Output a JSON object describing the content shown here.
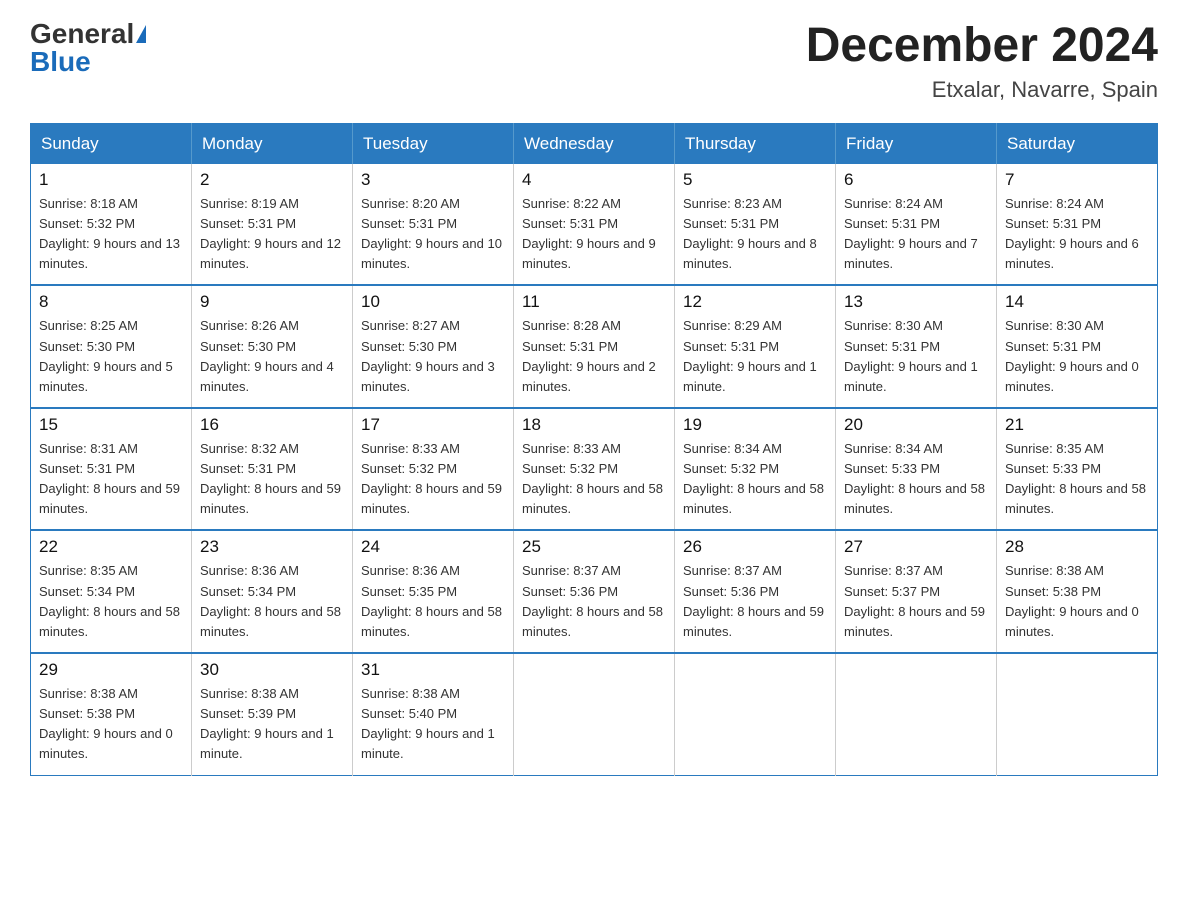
{
  "header": {
    "logo_general": "General",
    "logo_blue": "Blue",
    "month_title": "December 2024",
    "location": "Etxalar, Navarre, Spain"
  },
  "days_of_week": [
    "Sunday",
    "Monday",
    "Tuesday",
    "Wednesday",
    "Thursday",
    "Friday",
    "Saturday"
  ],
  "weeks": [
    [
      {
        "day": "1",
        "sunrise": "8:18 AM",
        "sunset": "5:32 PM",
        "daylight": "9 hours and 13 minutes."
      },
      {
        "day": "2",
        "sunrise": "8:19 AM",
        "sunset": "5:31 PM",
        "daylight": "9 hours and 12 minutes."
      },
      {
        "day": "3",
        "sunrise": "8:20 AM",
        "sunset": "5:31 PM",
        "daylight": "9 hours and 10 minutes."
      },
      {
        "day": "4",
        "sunrise": "8:22 AM",
        "sunset": "5:31 PM",
        "daylight": "9 hours and 9 minutes."
      },
      {
        "day": "5",
        "sunrise": "8:23 AM",
        "sunset": "5:31 PM",
        "daylight": "9 hours and 8 minutes."
      },
      {
        "day": "6",
        "sunrise": "8:24 AM",
        "sunset": "5:31 PM",
        "daylight": "9 hours and 7 minutes."
      },
      {
        "day": "7",
        "sunrise": "8:24 AM",
        "sunset": "5:31 PM",
        "daylight": "9 hours and 6 minutes."
      }
    ],
    [
      {
        "day": "8",
        "sunrise": "8:25 AM",
        "sunset": "5:30 PM",
        "daylight": "9 hours and 5 minutes."
      },
      {
        "day": "9",
        "sunrise": "8:26 AM",
        "sunset": "5:30 PM",
        "daylight": "9 hours and 4 minutes."
      },
      {
        "day": "10",
        "sunrise": "8:27 AM",
        "sunset": "5:30 PM",
        "daylight": "9 hours and 3 minutes."
      },
      {
        "day": "11",
        "sunrise": "8:28 AM",
        "sunset": "5:31 PM",
        "daylight": "9 hours and 2 minutes."
      },
      {
        "day": "12",
        "sunrise": "8:29 AM",
        "sunset": "5:31 PM",
        "daylight": "9 hours and 1 minute."
      },
      {
        "day": "13",
        "sunrise": "8:30 AM",
        "sunset": "5:31 PM",
        "daylight": "9 hours and 1 minute."
      },
      {
        "day": "14",
        "sunrise": "8:30 AM",
        "sunset": "5:31 PM",
        "daylight": "9 hours and 0 minutes."
      }
    ],
    [
      {
        "day": "15",
        "sunrise": "8:31 AM",
        "sunset": "5:31 PM",
        "daylight": "8 hours and 59 minutes."
      },
      {
        "day": "16",
        "sunrise": "8:32 AM",
        "sunset": "5:31 PM",
        "daylight": "8 hours and 59 minutes."
      },
      {
        "day": "17",
        "sunrise": "8:33 AM",
        "sunset": "5:32 PM",
        "daylight": "8 hours and 59 minutes."
      },
      {
        "day": "18",
        "sunrise": "8:33 AM",
        "sunset": "5:32 PM",
        "daylight": "8 hours and 58 minutes."
      },
      {
        "day": "19",
        "sunrise": "8:34 AM",
        "sunset": "5:32 PM",
        "daylight": "8 hours and 58 minutes."
      },
      {
        "day": "20",
        "sunrise": "8:34 AM",
        "sunset": "5:33 PM",
        "daylight": "8 hours and 58 minutes."
      },
      {
        "day": "21",
        "sunrise": "8:35 AM",
        "sunset": "5:33 PM",
        "daylight": "8 hours and 58 minutes."
      }
    ],
    [
      {
        "day": "22",
        "sunrise": "8:35 AM",
        "sunset": "5:34 PM",
        "daylight": "8 hours and 58 minutes."
      },
      {
        "day": "23",
        "sunrise": "8:36 AM",
        "sunset": "5:34 PM",
        "daylight": "8 hours and 58 minutes."
      },
      {
        "day": "24",
        "sunrise": "8:36 AM",
        "sunset": "5:35 PM",
        "daylight": "8 hours and 58 minutes."
      },
      {
        "day": "25",
        "sunrise": "8:37 AM",
        "sunset": "5:36 PM",
        "daylight": "8 hours and 58 minutes."
      },
      {
        "day": "26",
        "sunrise": "8:37 AM",
        "sunset": "5:36 PM",
        "daylight": "8 hours and 59 minutes."
      },
      {
        "day": "27",
        "sunrise": "8:37 AM",
        "sunset": "5:37 PM",
        "daylight": "8 hours and 59 minutes."
      },
      {
        "day": "28",
        "sunrise": "8:38 AM",
        "sunset": "5:38 PM",
        "daylight": "9 hours and 0 minutes."
      }
    ],
    [
      {
        "day": "29",
        "sunrise": "8:38 AM",
        "sunset": "5:38 PM",
        "daylight": "9 hours and 0 minutes."
      },
      {
        "day": "30",
        "sunrise": "8:38 AM",
        "sunset": "5:39 PM",
        "daylight": "9 hours and 1 minute."
      },
      {
        "day": "31",
        "sunrise": "8:38 AM",
        "sunset": "5:40 PM",
        "daylight": "9 hours and 1 minute."
      },
      null,
      null,
      null,
      null
    ]
  ]
}
